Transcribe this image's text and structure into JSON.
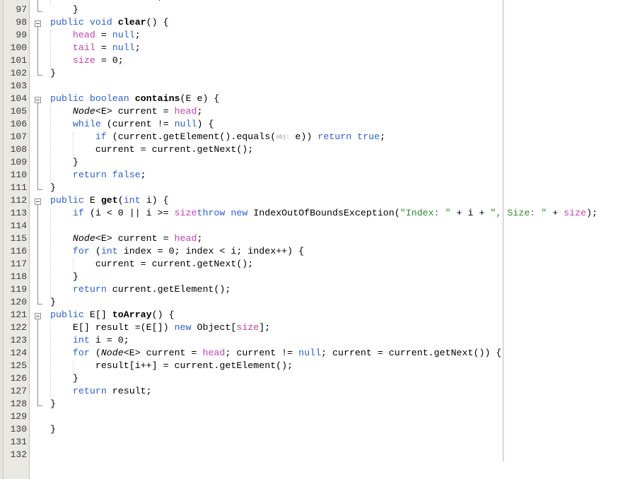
{
  "editor": {
    "first_line_partial": "return null;",
    "lines": [
      {
        "n": "97"
      },
      {
        "n": "98"
      },
      {
        "n": "99"
      },
      {
        "n": "100"
      },
      {
        "n": "101"
      },
      {
        "n": "102"
      },
      {
        "n": "103"
      },
      {
        "n": "104"
      },
      {
        "n": "105"
      },
      {
        "n": "106"
      },
      {
        "n": "107"
      },
      {
        "n": "108"
      },
      {
        "n": "109"
      },
      {
        "n": "110"
      },
      {
        "n": "111"
      },
      {
        "n": "112"
      },
      {
        "n": "113"
      },
      {
        "n": "114"
      },
      {
        "n": "115"
      },
      {
        "n": "116"
      },
      {
        "n": "117"
      },
      {
        "n": "118"
      },
      {
        "n": "119"
      },
      {
        "n": "120"
      },
      {
        "n": "121"
      },
      {
        "n": "122"
      },
      {
        "n": "123"
      },
      {
        "n": "124"
      },
      {
        "n": "125"
      },
      {
        "n": "126"
      },
      {
        "n": "127"
      },
      {
        "n": "128"
      },
      {
        "n": "129"
      },
      {
        "n": "130"
      },
      {
        "n": "131"
      },
      {
        "n": "132"
      }
    ],
    "code": {
      "l96": [
        [
          "kw",
          "        return "
        ],
        [
          "kw",
          "null"
        ],
        [
          "",
          "; "
        ]
      ],
      "l97": [
        [
          "",
          "    }"
        ]
      ],
      "l98": [
        [
          "kw",
          "public void "
        ],
        [
          "bold",
          "clear"
        ],
        [
          "",
          "() {"
        ]
      ],
      "l99": [
        [
          "",
          "    "
        ],
        [
          "fld",
          "head"
        ],
        [
          "",
          " = "
        ],
        [
          "kw",
          "null"
        ],
        [
          "",
          ";"
        ]
      ],
      "l100": [
        [
          "",
          "    "
        ],
        [
          "fld",
          "tail"
        ],
        [
          "",
          " = "
        ],
        [
          "kw",
          "null"
        ],
        [
          "",
          ";"
        ]
      ],
      "l101": [
        [
          "",
          "    "
        ],
        [
          "fld",
          "size"
        ],
        [
          "",
          " = 0;"
        ]
      ],
      "l102": [
        [
          "",
          "}"
        ]
      ],
      "l103": [],
      "l104": [
        [
          "kw",
          "public boolean "
        ],
        [
          "bold",
          "contains"
        ],
        [
          "",
          "(E e) {"
        ]
      ],
      "l105": [
        [
          "",
          "    "
        ],
        [
          "typ",
          "Node"
        ],
        [
          "",
          "<E> current = "
        ],
        [
          "fld",
          "head"
        ],
        [
          "",
          ";"
        ]
      ],
      "l106": [
        [
          "kw",
          "    while"
        ],
        [
          "",
          " (current != "
        ],
        [
          "kw",
          "null"
        ],
        [
          "",
          ") {"
        ]
      ],
      "l107": [
        [
          "kw",
          "        if"
        ],
        [
          "",
          " (current.getElement().equals("
        ],
        [
          "hint",
          "obj:"
        ],
        [
          "",
          " e)) "
        ],
        [
          "kw",
          "return true"
        ],
        [
          "",
          ";"
        ]
      ],
      "l108": [
        [
          "",
          "        current = current.getNext();"
        ]
      ],
      "l109": [
        [
          "",
          "    }"
        ]
      ],
      "l110": [
        [
          "kw",
          "    return false"
        ],
        [
          "",
          ";"
        ]
      ],
      "l111": [
        [
          "",
          "}"
        ]
      ],
      "l112": [
        [
          "kw",
          "public "
        ],
        [
          "",
          "E "
        ],
        [
          "bold",
          "get"
        ],
        [
          "",
          "("
        ],
        [
          "kw",
          "int"
        ],
        [
          "",
          " i) {"
        ]
      ],
      "l113": [
        [
          "kw",
          "    if"
        ],
        [
          "",
          " (i < 0 || i >= "
        ],
        [
          "fld",
          "size"
        ],
        [
          ") "
        ],
        [
          "kw",
          "throw new "
        ],
        [
          "",
          "IndexOutOfBoundsException("
        ],
        [
          "str",
          "\"Index: \""
        ],
        [
          "",
          " + i + "
        ],
        [
          "str",
          "\", Size: \""
        ],
        [
          "",
          " + "
        ],
        [
          "fld",
          "size"
        ],
        [
          "",
          ");"
        ]
      ],
      "l114": [],
      "l115": [
        [
          "",
          "    "
        ],
        [
          "typ",
          "Node"
        ],
        [
          "",
          "<E> current = "
        ],
        [
          "fld",
          "head"
        ],
        [
          "",
          ";"
        ]
      ],
      "l116": [
        [
          "kw",
          "    for"
        ],
        [
          "",
          " ("
        ],
        [
          "kw",
          "int"
        ],
        [
          "",
          " index = 0; index < i; index++) {"
        ]
      ],
      "l117": [
        [
          "",
          "        current = current.getNext();"
        ]
      ],
      "l118": [
        [
          "",
          "    }"
        ]
      ],
      "l119": [
        [
          "kw",
          "    return"
        ],
        [
          "",
          " current.getElement();"
        ]
      ],
      "l120": [
        [
          "",
          "}"
        ]
      ],
      "l121": [
        [
          "kw",
          "public "
        ],
        [
          "",
          "E[] "
        ],
        [
          "bold",
          "toArray"
        ],
        [
          "",
          "() {"
        ]
      ],
      "l122": [
        [
          "",
          "    E[] result =(E[]) "
        ],
        [
          "kw",
          "new "
        ],
        [
          "",
          "Object["
        ],
        [
          "fld",
          "size"
        ],
        [
          "",
          "];"
        ]
      ],
      "l123": [
        [
          "kw",
          "    int"
        ],
        [
          "",
          " i = 0;"
        ]
      ],
      "l124": [
        [
          "kw",
          "    for"
        ],
        [
          "",
          " ("
        ],
        [
          "typ",
          "Node"
        ],
        [
          "",
          "<E> current = "
        ],
        [
          "fld",
          "head"
        ],
        [
          "",
          "; current != "
        ],
        [
          "kw",
          "null"
        ],
        [
          "",
          "; current = current.getNext()) {"
        ]
      ],
      "l125": [
        [
          "",
          "        result[i++] = current.getElement();"
        ]
      ],
      "l126": [
        [
          "",
          "    }"
        ]
      ],
      "l127": [
        [
          "kw",
          "    return"
        ],
        [
          "",
          " result;"
        ]
      ],
      "l128": [
        [
          "",
          "}"
        ]
      ],
      "l129": [],
      "l130": [
        [
          "",
          "}"
        ]
      ],
      "l131": [],
      "l132": []
    },
    "colors": {
      "keyword": "#2b5fd0",
      "field": "#c441b3",
      "string": "#2d8a2d",
      "gutter_bg": "#e9e8e2",
      "right_margin": "#d3a6cf"
    }
  }
}
